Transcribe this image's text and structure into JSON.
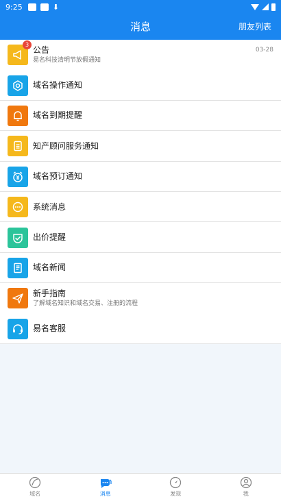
{
  "status": {
    "time": "9:25",
    "download_glyph": "⬇"
  },
  "header": {
    "title": "消息",
    "right_label": "朋友列表"
  },
  "messages": [
    {
      "title": "公告",
      "subtitle": "易名科技清明节放假通知",
      "date": "03-28",
      "badge": "3",
      "icon": "megaphone-icon",
      "color": "#f5b81c"
    },
    {
      "title": "域名操作通知",
      "icon": "gear-icon",
      "color": "#18a4e8"
    },
    {
      "title": "域名到期提醒",
      "icon": "bell-icon",
      "color": "#f0780e"
    },
    {
      "title": "知产顾问服务通知",
      "icon": "document-icon",
      "color": "#f5b81c"
    },
    {
      "title": "域名预订通知",
      "icon": "alarm-yen-icon",
      "color": "#18a4e8"
    },
    {
      "title": "系统消息",
      "icon": "chat-dots-icon",
      "color": "#f5b81c"
    },
    {
      "title": "出价提醒",
      "icon": "shield-check-icon",
      "color": "#2bc49a"
    },
    {
      "title": "域名新闻",
      "icon": "newspaper-icon",
      "color": "#18a4e8"
    },
    {
      "title": "新手指南",
      "subtitle": "了解域名知识和域名交易、注册的流程",
      "icon": "paper-plane-icon",
      "color": "#f0780e"
    },
    {
      "title": "易名客服",
      "icon": "headset-icon",
      "color": "#18a4e8"
    }
  ],
  "tabs": [
    {
      "label": "域名",
      "icon": "domain-icon",
      "active": false
    },
    {
      "label": "消息",
      "icon": "message-icon",
      "active": true
    },
    {
      "label": "发现",
      "icon": "compass-icon",
      "active": false
    },
    {
      "label": "我",
      "icon": "user-icon",
      "active": false
    }
  ],
  "colors": {
    "brand": "#1a86f0",
    "badge": "#e8463a",
    "background": "#f1f6fb"
  }
}
